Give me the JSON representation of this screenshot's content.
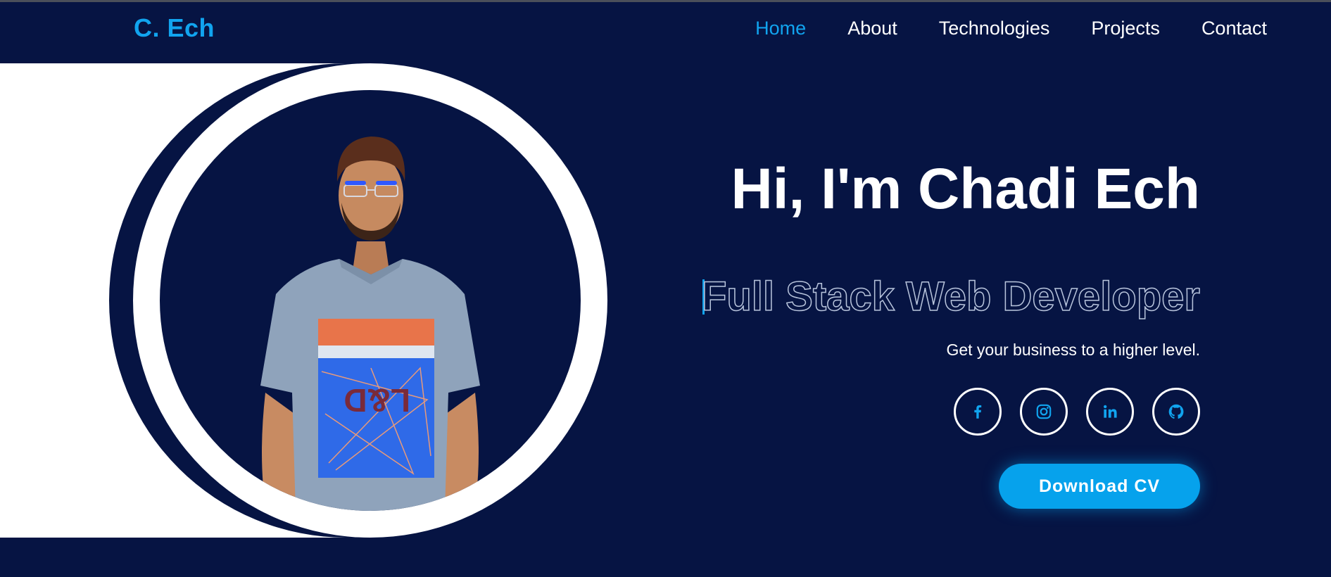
{
  "nav": {
    "brand": "C. Ech",
    "links": [
      {
        "label": "Home",
        "active": true
      },
      {
        "label": "About",
        "active": false
      },
      {
        "label": "Technologies",
        "active": false
      },
      {
        "label": "Projects",
        "active": false
      },
      {
        "label": "Contact",
        "active": false
      }
    ]
  },
  "hero": {
    "title": "Hi, I'm Chadi Ech",
    "role": "Full Stack Web Developer",
    "tagline": "Get your business to a higher level.",
    "cv_button": "Download CV",
    "photo_icon": "profile-photo",
    "shirt_print": "L&D",
    "social": [
      {
        "icon": "facebook-icon"
      },
      {
        "icon": "instagram-icon"
      },
      {
        "icon": "linkedin-icon"
      },
      {
        "icon": "github-icon"
      }
    ]
  },
  "colors": {
    "background": "#061443",
    "accent": "#11a4ef",
    "button": "#06a2ec",
    "white": "#ffffff"
  }
}
